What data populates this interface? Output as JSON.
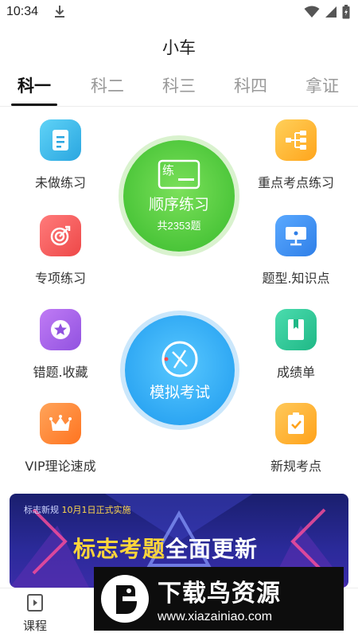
{
  "status": {
    "time": "10:34"
  },
  "header": {
    "title": "小车"
  },
  "tabs": [
    {
      "label": "科一",
      "active": true
    },
    {
      "label": "科二",
      "active": false
    },
    {
      "label": "科三",
      "active": false
    },
    {
      "label": "科四",
      "active": false
    },
    {
      "label": "拿证",
      "active": false
    }
  ],
  "features": {
    "undone": {
      "label": "未做练习",
      "icon": "document-icon",
      "color": "#36b8e8"
    },
    "key_points": {
      "label": "重点考点练习",
      "icon": "flowchart-icon",
      "color": "#ffb82e"
    },
    "special": {
      "label": "专项练习",
      "icon": "target-icon",
      "color": "#f25a5a"
    },
    "types": {
      "label": "题型.知识点",
      "icon": "monitor-icon",
      "color": "#3a8ff0"
    },
    "wrong": {
      "label": "错题.收藏",
      "icon": "star-icon",
      "color": "#a55ee8"
    },
    "scores": {
      "label": "成绩单",
      "icon": "bookmark-icon",
      "color": "#2dc99a"
    },
    "vip": {
      "label": "VIP理论速成",
      "icon": "crown-icon",
      "color": "#ff8a2e"
    },
    "new_rules": {
      "label": "新规考点",
      "icon": "checklist-icon",
      "color": "#ffb02a"
    }
  },
  "sequential": {
    "badge": "练",
    "title": "顺序练习",
    "count": "共2353题",
    "color": "#4cc63a"
  },
  "mock_exam": {
    "title": "模拟考试",
    "color": "#2ea7f3"
  },
  "banner": {
    "top_prefix": "标志新规",
    "top_date": "10月1日正式实施",
    "title_a": "标志考题",
    "title_b": "全面",
    "title_c": "更新"
  },
  "bottom_nav": {
    "courses_label": "课程"
  },
  "watermark": {
    "text": "下载鸟资源",
    "url": "www.xiazainiao.com"
  }
}
